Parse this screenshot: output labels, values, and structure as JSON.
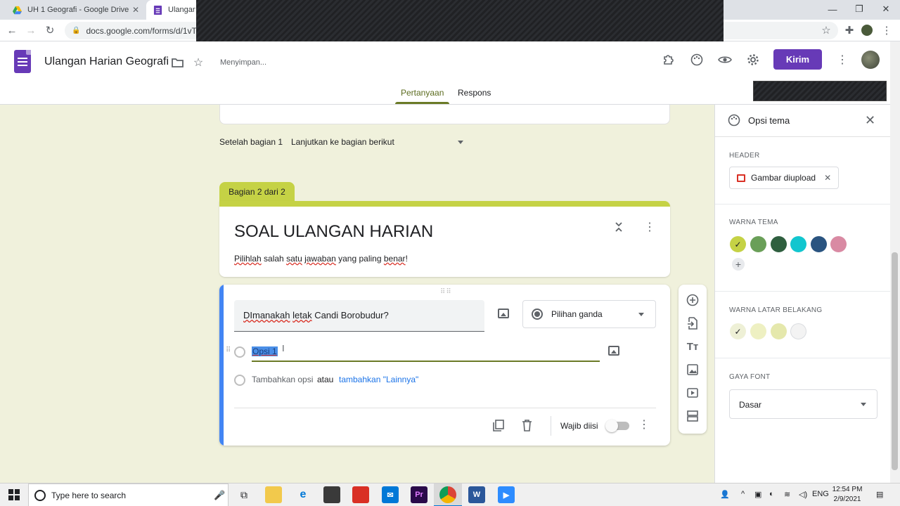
{
  "browser": {
    "tabs": [
      {
        "title": "UH 1 Geografi - Google Drive"
      },
      {
        "title": "Ulangan H"
      }
    ],
    "url": "docs.google.com/forms/d/1vT-"
  },
  "header": {
    "form_title": "Ulangan Harian Geografi",
    "status": "Menyimpan...",
    "send_label": "Kirim",
    "tabs": [
      {
        "label": "Pertanyaan",
        "active": true
      },
      {
        "label": "Respons",
        "active": false
      }
    ]
  },
  "editor": {
    "after_section_label": "Setelah bagian 1",
    "after_section_value": "Lanjutkan ke bagian berikut",
    "section_tag": "Bagian 2 dari 2",
    "section_title": "SOAL ULANGAN HARIAN",
    "section_desc_parts": [
      "Pilihlah",
      " salah ",
      "satu",
      " ",
      "jawaban",
      " yang paling ",
      "benar",
      "!"
    ],
    "question": {
      "title_parts": [
        "DImanakah",
        " ",
        "letak",
        " Candi Borobudur?"
      ],
      "type": "Pilihan ganda",
      "option_1": "Opsi 1",
      "add_option": "Tambahkan opsi",
      "or": "atau",
      "add_other": "tambahkan \"Lainnya\"",
      "required_label": "Wajib diisi",
      "required": false
    }
  },
  "theme_panel": {
    "title": "Opsi tema",
    "header_label": "HEADER",
    "header_chip": "Gambar diupload",
    "theme_color_label": "WARNA TEMA",
    "theme_colors": [
      "#c5d245",
      "#6a9f58",
      "#2f5f3f",
      "#12c6cf",
      "#2a5480",
      "#d98aa3"
    ],
    "bg_color_label": "WARNA LATAR BELAKANG",
    "bg_colors": [
      "#eef0d6",
      "#eef0c2",
      "#e5e8ac",
      "#f3f3f3"
    ],
    "font_label": "GAYA FONT",
    "font_value": "Dasar"
  },
  "taskbar": {
    "search_placeholder": "Type here to search",
    "lang": "ENG",
    "time": "12:54 PM",
    "date": "2/9/2021"
  }
}
